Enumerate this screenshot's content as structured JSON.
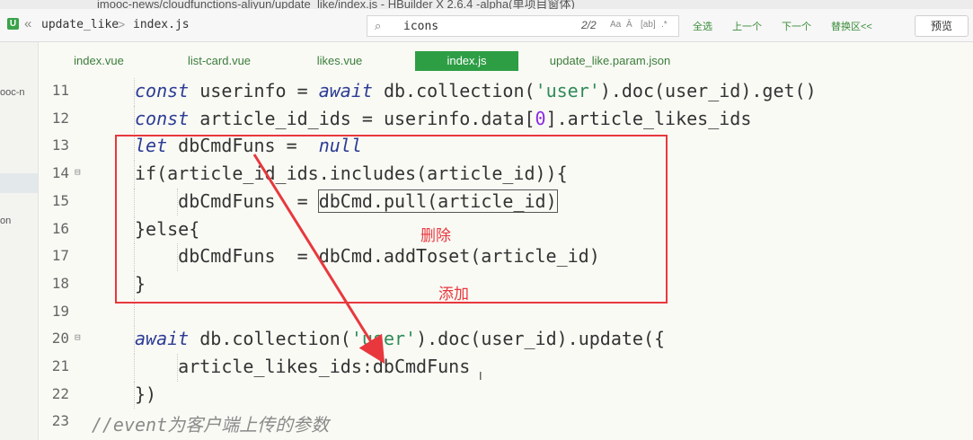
{
  "window": {
    "title": "imooc-news/cloudfunctions-aliyun/update_like/index.js - HBuilder X 2.6.4 -alpha(单项目窗体)"
  },
  "toolbar": {
    "nav_arrows": "«",
    "breadcrumb": [
      "update_like",
      "index.js"
    ],
    "breadcrumb_sep": ">",
    "search": {
      "value": "icons",
      "count": "2/2"
    },
    "search_options": [
      "Aa",
      "Ā",
      "[ab]",
      ".*"
    ],
    "find_buttons": [
      "全选",
      "上一个",
      "下一个",
      "替换区<<"
    ],
    "preview_label": "预览"
  },
  "sidebar": {
    "items": [
      "ooc-n",
      "on"
    ]
  },
  "tabs": [
    {
      "label": "index.vue",
      "active": false
    },
    {
      "label": "list-card.vue",
      "active": false
    },
    {
      "label": "likes.vue",
      "active": false
    },
    {
      "label": "index.js",
      "active": true
    },
    {
      "label": "update_like.param.json",
      "active": false
    }
  ],
  "editor": {
    "lines": [
      {
        "num": "11",
        "fold": false,
        "indent": 1,
        "tokens": [
          [
            "kw",
            "const"
          ],
          [
            "p",
            " userinfo = "
          ],
          [
            "kw",
            "await"
          ],
          [
            "p",
            " db.collection("
          ],
          [
            "str",
            "'user'"
          ],
          [
            "p",
            ").doc(user_id).get()"
          ]
        ]
      },
      {
        "num": "12",
        "fold": false,
        "indent": 1,
        "tokens": [
          [
            "kw",
            "const"
          ],
          [
            "p",
            " article_id_ids = userinfo.data["
          ],
          [
            "num",
            "0"
          ],
          [
            "p",
            "].article_likes_ids"
          ]
        ]
      },
      {
        "num": "13",
        "fold": false,
        "indent": 1,
        "tokens": [
          [
            "kw",
            "let"
          ],
          [
            "p",
            " dbCmdFuns =  "
          ],
          [
            "kw",
            "null"
          ]
        ]
      },
      {
        "num": "14",
        "fold": true,
        "indent": 1,
        "tokens": [
          [
            "p",
            "if(article_id_ids.includes(article_id)){"
          ]
        ]
      },
      {
        "num": "15",
        "fold": false,
        "indent": 2,
        "tokens": [
          [
            "p",
            "dbCmdFuns  = "
          ],
          [
            "boxed",
            "dbCmd.pull(article_id)"
          ]
        ]
      },
      {
        "num": "16",
        "fold": false,
        "indent": 1,
        "tokens": [
          [
            "p",
            "}else{"
          ]
        ]
      },
      {
        "num": "17",
        "fold": false,
        "indent": 2,
        "tokens": [
          [
            "p",
            "dbCmdFuns  = dbCmd.addToset(article_id)"
          ]
        ]
      },
      {
        "num": "18",
        "fold": false,
        "indent": 1,
        "tokens": [
          [
            "p",
            "}"
          ]
        ]
      },
      {
        "num": "19",
        "fold": false,
        "indent": 1,
        "tokens": []
      },
      {
        "num": "20",
        "fold": true,
        "indent": 1,
        "tokens": [
          [
            "kw",
            "await"
          ],
          [
            "p",
            " db.collection("
          ],
          [
            "str",
            "'user'"
          ],
          [
            "p",
            ").doc(user_id).update({"
          ]
        ]
      },
      {
        "num": "21",
        "fold": false,
        "indent": 2,
        "tokens": [
          [
            "p",
            "article_likes_ids:dbCmdFuns"
          ]
        ]
      },
      {
        "num": "22",
        "fold": false,
        "indent": 1,
        "tokens": [
          [
            "p",
            "})"
          ]
        ]
      },
      {
        "num": "23",
        "fold": false,
        "indent": 0,
        "tokens": [
          [
            "com",
            "//event为客户端上传的参数"
          ]
        ]
      }
    ]
  },
  "annotations": {
    "delete_label": "删除",
    "add_label": "添加"
  },
  "colors": {
    "annotation": "#e8383d",
    "active_tab": "#2e9e45"
  },
  "text_cursor": "I"
}
